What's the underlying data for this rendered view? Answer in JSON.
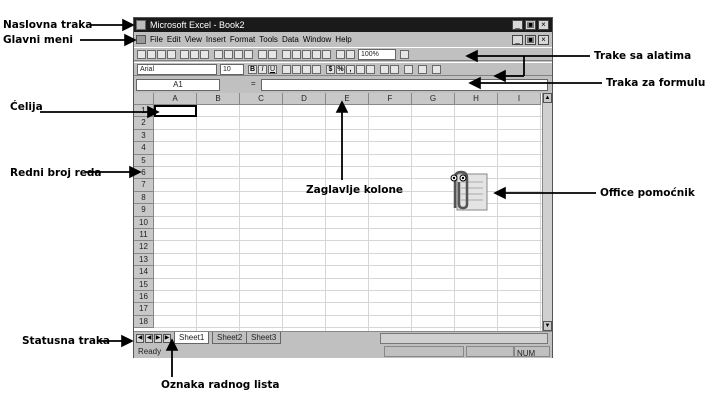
{
  "window": {
    "title": "Microsoft Excel - Book2",
    "buttons": [
      "_",
      "▣",
      "×"
    ],
    "doc_buttons": [
      "_",
      "▣",
      "×"
    ]
  },
  "menu": [
    "File",
    "Edit",
    "View",
    "Insert",
    "Format",
    "Tools",
    "Data",
    "Window",
    "Help"
  ],
  "toolbar": {
    "font": "Arial",
    "size": "10",
    "zoom": "100%",
    "bold": "B",
    "italic": "I",
    "underline": "U",
    "currency": "$",
    "percent": "%",
    "comma": ","
  },
  "formula_bar": {
    "name_box": "A1",
    "equals": "="
  },
  "columns": [
    "A",
    "B",
    "C",
    "D",
    "E",
    "F",
    "G",
    "H",
    "I"
  ],
  "rows": [
    "1",
    "2",
    "3",
    "4",
    "5",
    "6",
    "7",
    "8",
    "9",
    "10",
    "11",
    "12",
    "13",
    "14",
    "15",
    "16",
    "17",
    "18"
  ],
  "sheets": [
    "Sheet1",
    "Sheet2",
    "Sheet3"
  ],
  "status": {
    "ready": "Ready",
    "num": "NUM"
  },
  "annotations": {
    "naslovna_traka": "Naslovna traka",
    "glavni_meni": "Glavni meni",
    "celija": "Ćelija",
    "redni_broj_reda": "Redni broj reda",
    "statusna_traka": "Statusna traka",
    "oznaka_radnog_lista": "Oznaka radnog lista",
    "trake_sa_alatima": "Trake sa alatima",
    "traka_za_formulu": "Traka za formulu",
    "zaglavlje_kolone": "Zaglavlje kolone",
    "office_pomocnik": "Office pomoćnik"
  }
}
